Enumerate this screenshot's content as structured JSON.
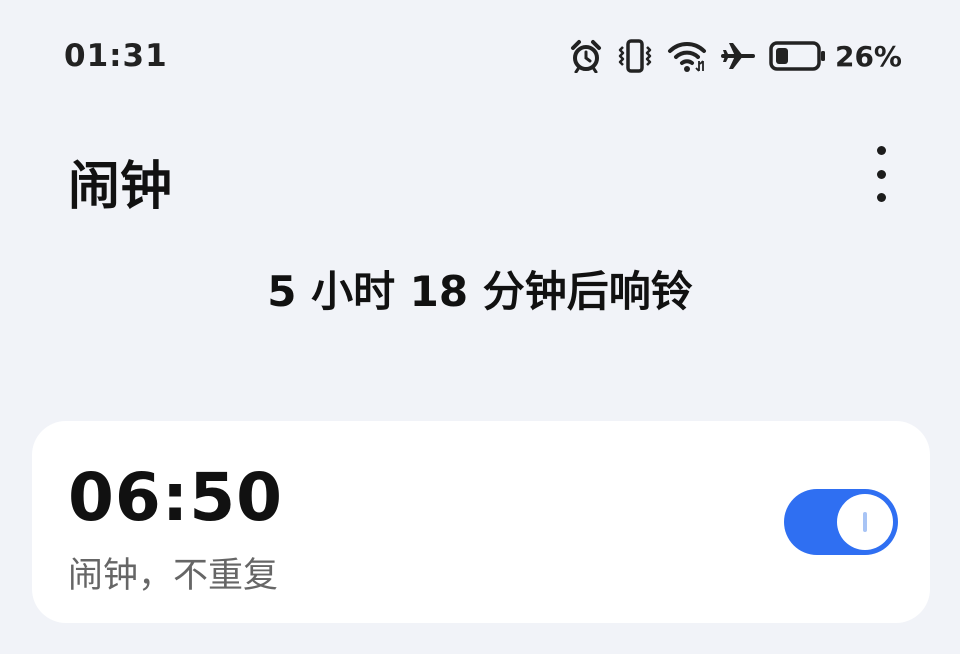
{
  "status_bar": {
    "time": "01:31",
    "battery_percent": "26%",
    "battery_level": 0.26,
    "icons": [
      "alarm-icon",
      "vibrate-icon",
      "wifi-icon",
      "airplane-icon",
      "battery-icon"
    ]
  },
  "header": {
    "title": "闹钟",
    "menu_icon": "more-vertical-icon"
  },
  "next_alarm_text": "5 小时 18 分钟后响铃",
  "alarms": [
    {
      "time": "06:50",
      "label": "闹钟，不重复",
      "enabled": true
    }
  ],
  "colors": {
    "background": "#f1f3f8",
    "card": "#ffffff",
    "accent": "#2f6ff2",
    "text_primary": "#111111",
    "text_secondary": "#666666"
  }
}
